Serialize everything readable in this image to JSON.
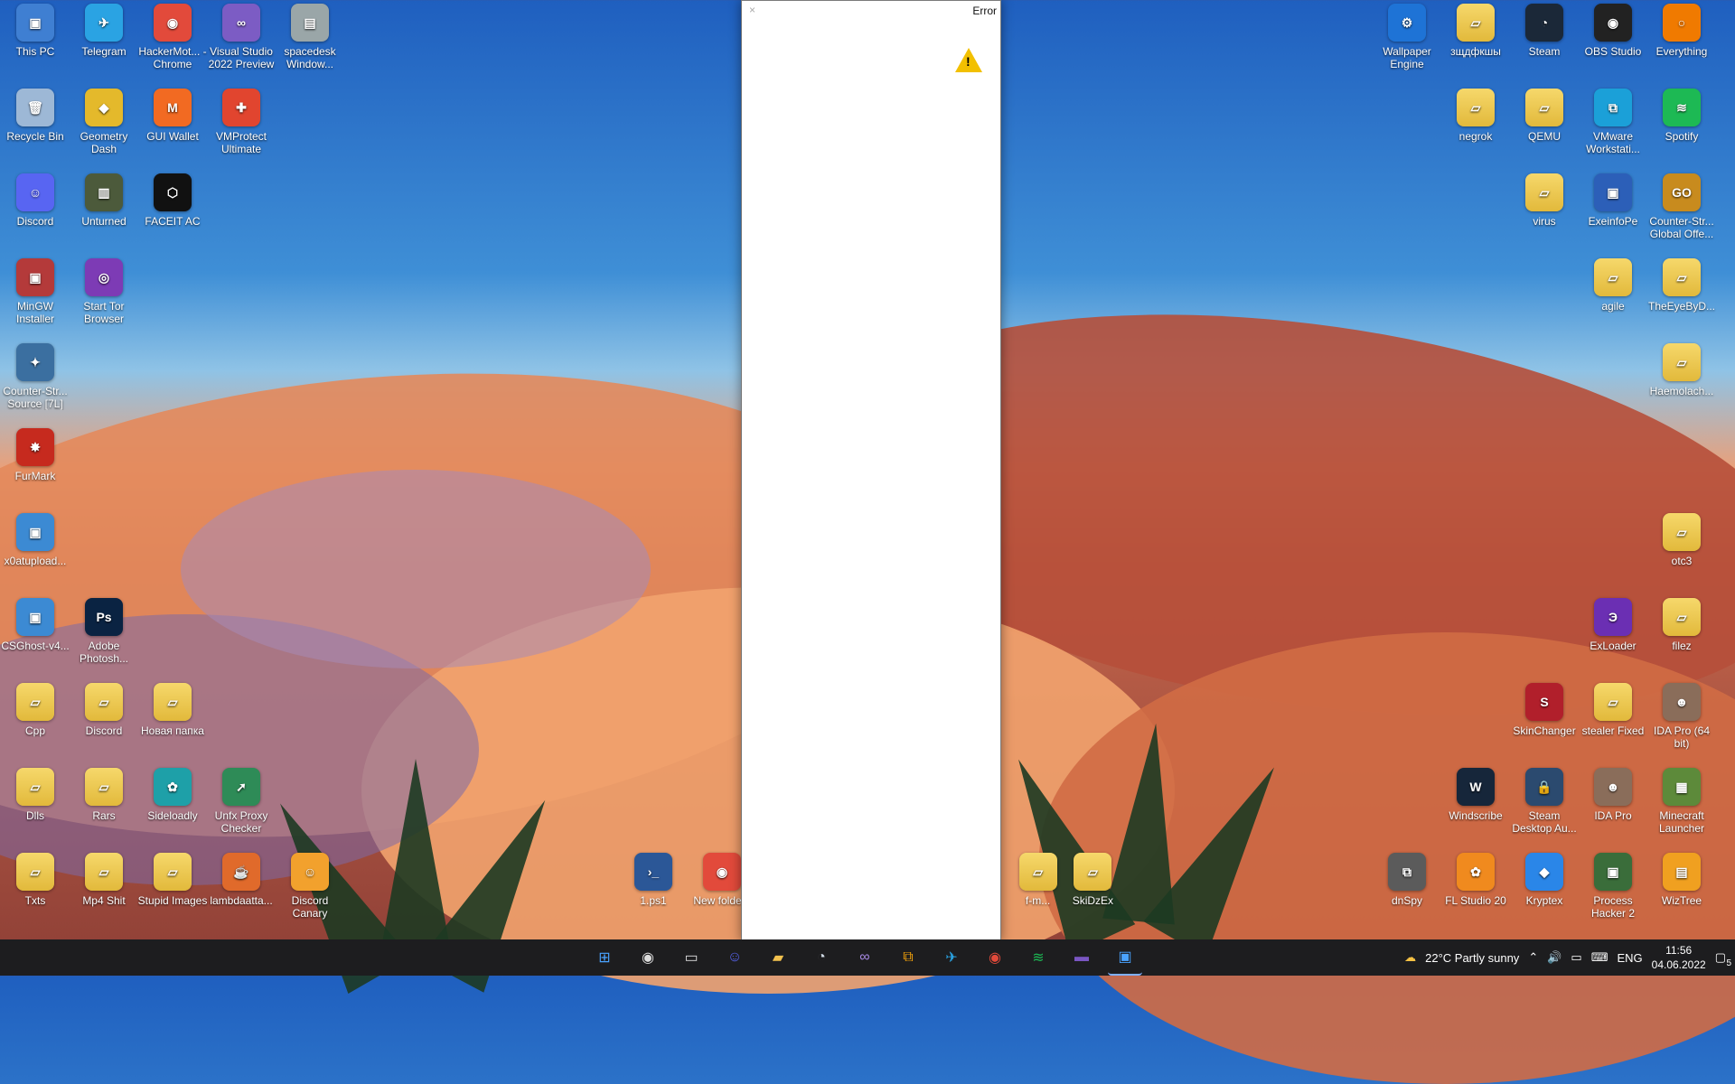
{
  "desktop": {
    "left_icons": [
      {
        "label": "This PC",
        "color": "#3f7fd2",
        "glyph": "▣"
      },
      {
        "label": "Telegram",
        "color": "#2aa3e3",
        "glyph": "✈"
      },
      {
        "label": "HackerMot... - Chrome",
        "color": "#e24a3b",
        "glyph": "◉"
      },
      {
        "label": "Visual Studio 2022 Preview",
        "color": "#7c5cc4",
        "glyph": "∞"
      },
      {
        "label": "spacedesk Window...",
        "color": "#9aa6a8",
        "glyph": "▤"
      },
      {
        "label": "Recycle Bin",
        "color": "#9db8d6",
        "glyph": "🗑"
      },
      {
        "label": "Geometry Dash",
        "color": "#e4b92b",
        "glyph": "◆"
      },
      {
        "label": "GUI Wallet",
        "color": "#f26a22",
        "glyph": "M"
      },
      {
        "label": "VMProtect Ultimate",
        "color": "#e1452f",
        "glyph": "✚"
      },
      {
        "label": "Discord",
        "color": "#5865f2",
        "glyph": "☺"
      },
      {
        "label": "Unturned",
        "color": "#4c5a3b",
        "glyph": "▥"
      },
      {
        "label": "FACEIT AC",
        "color": "#111",
        "glyph": "⬡"
      },
      {
        "label": "MinGW Installer",
        "color": "#b43a3a",
        "glyph": "▣"
      },
      {
        "label": "Start Tor Browser",
        "color": "#7d3bb5",
        "glyph": "◎"
      },
      {
        "label": "Counter-Str... Source [7L]",
        "color": "#3b6fa0",
        "glyph": "✦"
      },
      {
        "label": "FurMark",
        "color": "#c62a1e",
        "glyph": "✸"
      },
      {
        "label": "x0atupload...",
        "color": "#3c8ad3",
        "glyph": "▣"
      },
      {
        "label": "CSGhost-v4...",
        "color": "#3c8ad3",
        "glyph": "▣"
      },
      {
        "label": "Adobe Photosh...",
        "color": "#0a2342",
        "glyph": "Ps"
      },
      {
        "label": "Cpp",
        "folder": true,
        "glyph": "▱"
      },
      {
        "label": "Discord",
        "folder": true,
        "glyph": "▱"
      },
      {
        "label": "Новая папка",
        "folder": true,
        "glyph": "▱"
      },
      {
        "label": "Dlls",
        "folder": true,
        "glyph": "▱"
      },
      {
        "label": "Rars",
        "folder": true,
        "glyph": "▱"
      },
      {
        "label": "Sideloadly",
        "color": "#1ea0a8",
        "glyph": "✿"
      },
      {
        "label": "Unfx Proxy Checker",
        "color": "#2e8b57",
        "glyph": "➚"
      },
      {
        "label": "Txts",
        "folder": true,
        "glyph": "▱"
      },
      {
        "label": "Mp4 Shit",
        "folder": true,
        "glyph": "▱"
      },
      {
        "label": "Stupid Images",
        "folder": true,
        "glyph": "▱"
      },
      {
        "label": "lambdaatta...",
        "color": "#e06a2b",
        "glyph": "☕"
      },
      {
        "label": "Discord Canary",
        "color": "#f2a12d",
        "glyph": "☺"
      },
      {
        "label": "1.ps1",
        "color": "#2b5797",
        "glyph": "›_"
      },
      {
        "label": "New folde...",
        "color": "#e24a3b",
        "glyph": "◉"
      },
      {
        "label": "f-m...",
        "folder": true,
        "glyph": "▱"
      },
      {
        "label": "SkiDzEx",
        "folder": true,
        "glyph": "▱"
      }
    ],
    "right_icons": [
      {
        "label": "Wallpaper Engine",
        "color": "#1e73d6",
        "glyph": "⚙"
      },
      {
        "label": "зщдфкшы",
        "folder": true,
        "glyph": "▱"
      },
      {
        "label": "Steam",
        "color": "#1b2838",
        "glyph": "◔"
      },
      {
        "label": "OBS Studio",
        "color": "#222",
        "glyph": "◉"
      },
      {
        "label": "Everything",
        "color": "#f07a00",
        "glyph": "○"
      },
      {
        "label": "negrok",
        "folder": true,
        "glyph": "▱"
      },
      {
        "label": "QEMU",
        "folder": true,
        "glyph": "▱"
      },
      {
        "label": "VMware Workstati...",
        "color": "#1ba0d8",
        "glyph": "⧉"
      },
      {
        "label": "Spotify",
        "color": "#1db954",
        "glyph": "≋"
      },
      {
        "label": "virus",
        "folder": true,
        "glyph": "▱"
      },
      {
        "label": "ExeinfoPe",
        "color": "#2c5fb8",
        "glyph": "▣"
      },
      {
        "label": "Counter-Str... Global Offe...",
        "color": "#c88b1e",
        "glyph": "GO"
      },
      {
        "label": "agile",
        "folder": true,
        "glyph": "▱"
      },
      {
        "label": "TheEyeByD...",
        "folder": true,
        "glyph": "▱"
      },
      {
        "label": "Haemolach...",
        "folder": true,
        "glyph": "▱"
      },
      {
        "label": "otc3",
        "folder": true,
        "glyph": "▱"
      },
      {
        "label": "ExLoader",
        "color": "#6b2fb3",
        "glyph": "Э"
      },
      {
        "label": "filez",
        "folder": true,
        "glyph": "▱"
      },
      {
        "label": "SkinChanger",
        "color": "#b11f2b",
        "glyph": "S"
      },
      {
        "label": "stealer Fixed",
        "folder": true,
        "glyph": "▱"
      },
      {
        "label": "IDA Pro (64 bit)",
        "color": "#8a6d5a",
        "glyph": "☻"
      },
      {
        "label": "Windscribe",
        "color": "#16263a",
        "glyph": "W"
      },
      {
        "label": "Steam Desktop Au...",
        "color": "#2b4a6f",
        "glyph": "🔒"
      },
      {
        "label": "IDA Pro",
        "color": "#8a6d5a",
        "glyph": "☻"
      },
      {
        "label": "Minecraft Launcher",
        "color": "#5d8a3a",
        "glyph": "▦"
      },
      {
        "label": "dnSpy",
        "color": "#5b5b5b",
        "glyph": "⧉"
      },
      {
        "label": "FL Studio 20",
        "color": "#f08a1e",
        "glyph": "✿"
      },
      {
        "label": "Kryptex",
        "color": "#2a86e8",
        "glyph": "◆"
      },
      {
        "label": "Process Hacker 2",
        "color": "#3a6d3a",
        "glyph": "▣"
      },
      {
        "label": "WizTree",
        "color": "#f0a020",
        "glyph": "▤"
      }
    ]
  },
  "dialog": {
    "title": "Error",
    "close_glyph": "×",
    "warning_glyph": "!"
  },
  "taskbar": {
    "apps": [
      {
        "name": "start",
        "glyph": "⊞",
        "color": "#4aa3ff"
      },
      {
        "name": "obs",
        "glyph": "◉",
        "color": "#ddd"
      },
      {
        "name": "terminal",
        "glyph": "▭",
        "color": "#ddd"
      },
      {
        "name": "discord",
        "glyph": "☺",
        "color": "#5865f2"
      },
      {
        "name": "explorer",
        "glyph": "▰",
        "color": "#f2c14e"
      },
      {
        "name": "steam",
        "glyph": "◔",
        "color": "#cfd8e3"
      },
      {
        "name": "visual-studio",
        "glyph": "∞",
        "color": "#a98be6"
      },
      {
        "name": "vmware",
        "glyph": "⧉",
        "color": "#f2a10b"
      },
      {
        "name": "telegram",
        "glyph": "✈",
        "color": "#2aa3e3"
      },
      {
        "name": "chrome",
        "glyph": "◉",
        "color": "#e24a3b"
      },
      {
        "name": "spotify",
        "glyph": "≋",
        "color": "#1db954"
      },
      {
        "name": "ida",
        "glyph": "▬",
        "color": "#7a56c2"
      },
      {
        "name": "error-window",
        "glyph": "▣",
        "color": "#4aa3ff"
      }
    ],
    "weather": "22°C  Partly sunny",
    "language": "ENG",
    "time": "11:56",
    "date": "04.06.2022",
    "notifications": "5"
  }
}
